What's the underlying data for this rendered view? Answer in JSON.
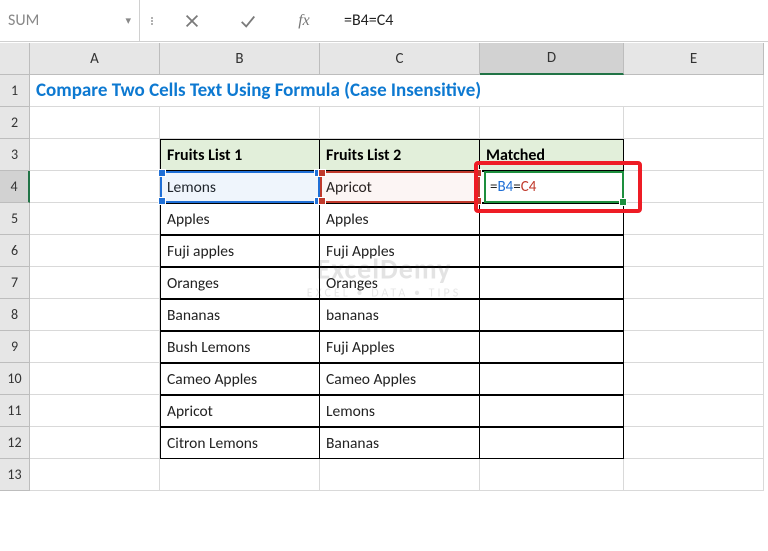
{
  "namebox": "SUM",
  "formula_bar": "=B4=C4",
  "fx_label": "fx",
  "columns": [
    "A",
    "B",
    "C",
    "D",
    "E"
  ],
  "rows": [
    "1",
    "2",
    "3",
    "4",
    "5",
    "6",
    "7",
    "8",
    "9",
    "10",
    "11",
    "12",
    "13"
  ],
  "title": "Compare Two Cells Text Using Formula (Case Insensitive)",
  "headers": {
    "b3": "Fruits List 1",
    "c3": "Fruits List 2",
    "d3": "Matched"
  },
  "table": {
    "b": [
      "Lemons",
      "Apples",
      "Fuji apples",
      "Oranges",
      "Bananas",
      "Bush Lemons",
      "Cameo Apples",
      "Apricot",
      "Citron Lemons"
    ],
    "c": [
      "Apricot",
      "Apples",
      "Fuji Apples",
      "Oranges",
      "bananas",
      "Fuji Apples",
      "Cameo Apples",
      "Lemons",
      "Bananas"
    ]
  },
  "active_formula": {
    "eq1": "=",
    "ref1": "B4",
    "eq2": "=",
    "ref2": "C4"
  },
  "watermark": {
    "big": "ExcelDemy",
    "small": "EXCEL • DATA • TIPS"
  }
}
